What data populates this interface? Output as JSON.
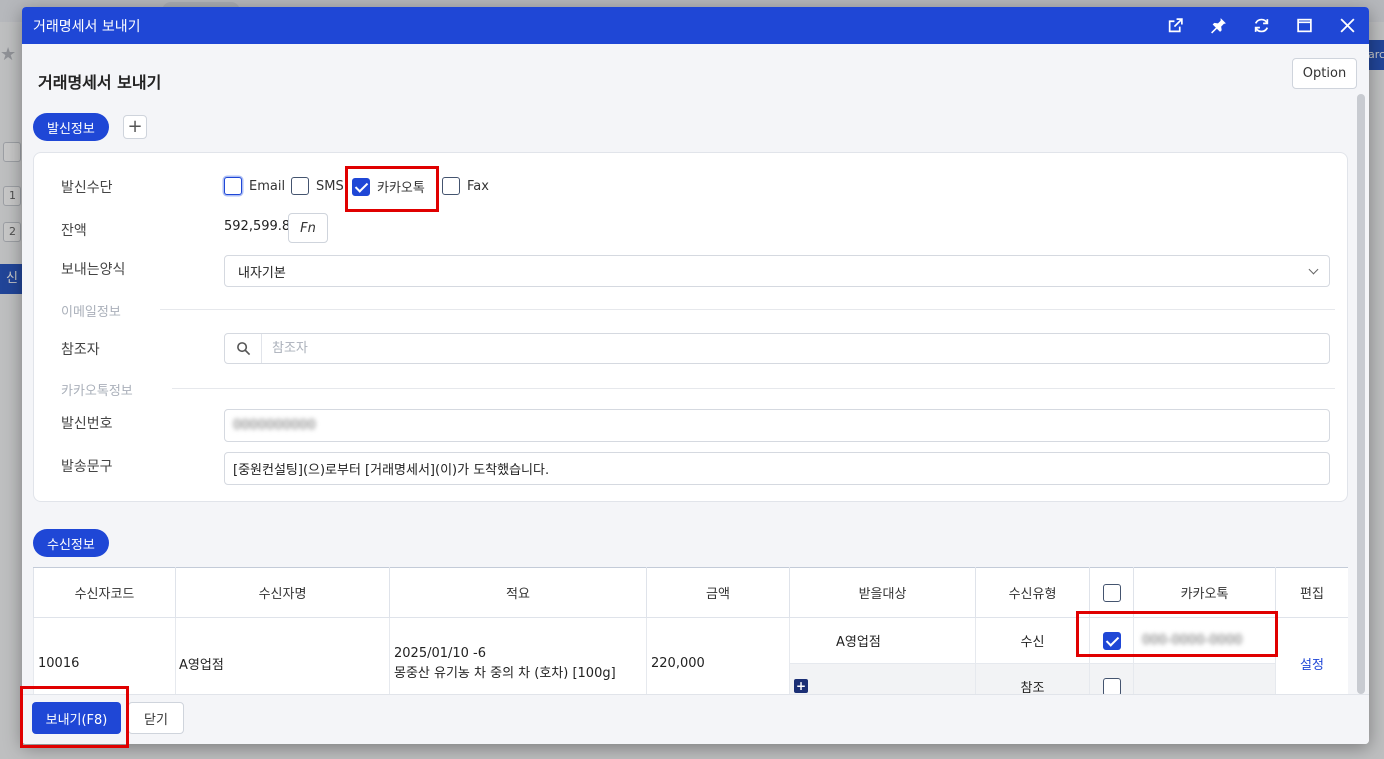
{
  "window": {
    "title": "거래명세서 보내기",
    "icons": [
      "external-link-icon",
      "pin-icon",
      "refresh-icon",
      "maximize-icon",
      "close-icon"
    ]
  },
  "page": {
    "title": "거래명세서 보내기",
    "option_label": "Option"
  },
  "sender": {
    "section_label": "발신정보",
    "add_label": "+",
    "method_label": "발신수단",
    "methods": [
      {
        "label": "Email",
        "checked": false
      },
      {
        "label": "SMS",
        "checked": false
      },
      {
        "label": "카카오톡",
        "checked": true
      },
      {
        "label": "Fax",
        "checked": false
      }
    ],
    "balance_label": "잔액",
    "balance_value": "592,599.8",
    "fn_label": "Fn",
    "format_label": "보내는양식",
    "format_value": "내자기본",
    "email_section": "이메일정보",
    "cc_label": "참조자",
    "cc_placeholder": "참조자",
    "kakao_section": "카카오톡정보",
    "sender_number_label": "발신번호",
    "send_message_label": "발송문구",
    "send_message_value": "[중원컨설팅](으)로부터 [거래명세서](이)가 도착했습니다."
  },
  "receiver": {
    "section_label": "수신정보",
    "columns": [
      "수신자코드",
      "수신자명",
      "적요",
      "금액",
      "받을대상",
      "수신유형",
      "",
      "카카오톡",
      "편집"
    ],
    "rows": [
      {
        "code": "10016",
        "name": "A영업점",
        "summary_line1": "2025/01/10 -6",
        "summary_line2": "몽중산 유기농 차 중의 차 (호차) [100g]",
        "amount": "220,000",
        "target": "A영업점",
        "type_receive": "수신",
        "type_cc": "참조",
        "edit": "설정"
      }
    ]
  },
  "footer": {
    "send_label": "보내기(F8)",
    "close_label": "닫기"
  },
  "colors": {
    "primary": "#1f47d6",
    "highlight_red": "#e00000"
  }
}
